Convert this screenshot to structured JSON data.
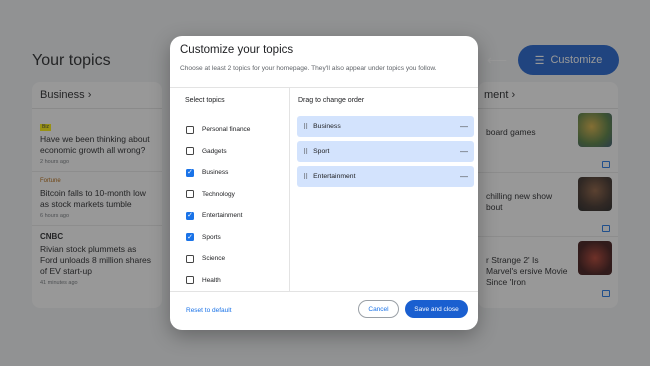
{
  "background": {
    "page_title": "Your topics",
    "left_column": {
      "heading": "Business ›",
      "stories": [
        {
          "source": "Biz",
          "headline": "Have we been thinking about economic growth all wrong?",
          "time": "2 hours ago"
        },
        {
          "source": "Fortune",
          "headline": "Bitcoin falls to 10-month low as stock markets tumble",
          "time": "6 hours ago"
        },
        {
          "source": "CNBC",
          "headline": "Rivian stock plummets as Ford unloads 8 million shares of EV start-up",
          "time": "41 minutes ago"
        }
      ]
    },
    "right_column": {
      "heading": "ment ›",
      "stories": [
        {
          "headline": "board games"
        },
        {
          "headline": "chilling new show bout"
        },
        {
          "headline": "r Strange 2' Is Marvel's ersive Movie Since 'Iron"
        }
      ]
    },
    "customize_button": "Customize",
    "arrow": "⟵"
  },
  "dialog": {
    "title": "Customize your topics",
    "subtitle": "Choose at least 2 topics for your homepage. They'll also appear under topics you follow.",
    "select_heading": "Select topics",
    "order_heading": "Drag to change order",
    "topics": [
      {
        "label": "Personal finance",
        "checked": false
      },
      {
        "label": "Gadgets",
        "checked": false
      },
      {
        "label": "Business",
        "checked": true
      },
      {
        "label": "Technology",
        "checked": false
      },
      {
        "label": "Entertainment",
        "checked": true
      },
      {
        "label": "Sports",
        "checked": true
      },
      {
        "label": "Science",
        "checked": false
      },
      {
        "label": "Health",
        "checked": false
      }
    ],
    "order": [
      "Business",
      "Sport",
      "Entertainment"
    ],
    "reset_label": "Reset to default",
    "cancel_label": "Cancel",
    "save_label": "Save and close"
  },
  "colors": {
    "accent": "#1a73e8",
    "primary_button": "#1a5fd0",
    "order_item_bg": "#d3e3fd"
  }
}
